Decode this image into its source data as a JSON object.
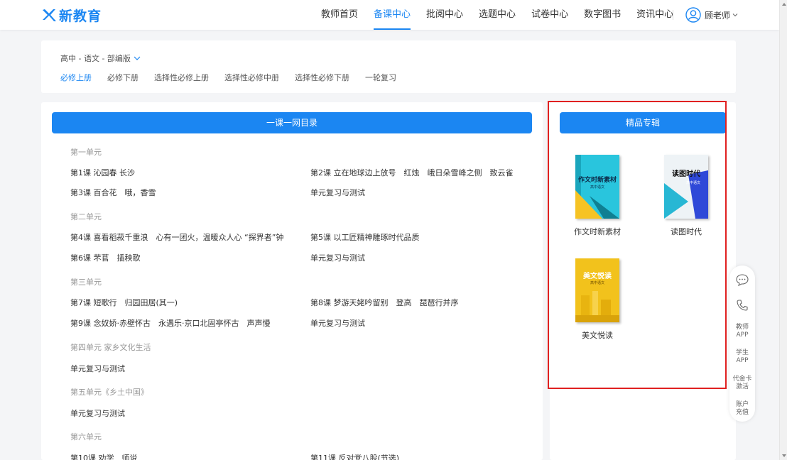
{
  "header": {
    "logo_text": "新教育",
    "nav": [
      "教师首页",
      "备课中心",
      "批阅中心",
      "选题中心",
      "试卷中心",
      "数字图书",
      "资讯中心"
    ],
    "active_nav": "备课中心",
    "user_name": "顾老师",
    "accent_color": "#1b86f2"
  },
  "filter": {
    "breadcrumb": "高中 - 语文 - 部编版",
    "tabs": [
      "必修上册",
      "必修下册",
      "选择性必修上册",
      "选择性必修中册",
      "选择性必修下册",
      "一轮复习"
    ],
    "active_tab": "必修上册"
  },
  "catalog": {
    "button_label": "一课一网目录",
    "units": [
      {
        "title": "第一单元",
        "lessons": [
          "第1课 沁园春 长沙",
          "第2课 立在地球边上放号　红烛　峨日朵雪峰之侧　致云雀",
          "第3课 百合花　哦，香雪",
          "单元复习与测试"
        ]
      },
      {
        "title": "第二单元",
        "lessons": [
          "第4课 喜看稻菽千重浪　心有一团火，温暖众人心 “探界者”钟...",
          "第5课 以工匠精神雕琢时代品质",
          "第6课 芣苢　插秧歌",
          "单元复习与测试"
        ]
      },
      {
        "title": "第三单元",
        "lessons": [
          "第7课 短歌行　归园田居(其一)",
          "第8课 梦游天姥吟留别　登高　琵琶行并序",
          "第9课 念奴娇·赤壁怀古　永遇乐·京口北固亭怀古　声声慢",
          "单元复习与测试"
        ]
      },
      {
        "title": "第四单元 家乡文化生活",
        "lessons": [
          "单元复习与测试"
        ]
      },
      {
        "title": "第五单元《乡土中国》",
        "lessons": [
          "单元复习与测试"
        ]
      },
      {
        "title": "第六单元",
        "lessons": [
          "第10课 劝学　师说",
          "第11课 反对党八股(节选)"
        ]
      }
    ]
  },
  "album": {
    "button_label": "精品专辑",
    "books": [
      {
        "label": "作文时新素材",
        "cover_title": "作文时新素材",
        "cover_sub": "高中语文"
      },
      {
        "label": "读图时代",
        "cover_title": "读图时代",
        "cover_sub": "高中语文"
      },
      {
        "label": "美文悦读",
        "cover_title": "美文悦读",
        "cover_sub": "高中语文"
      }
    ]
  },
  "side": {
    "teacher_app": [
      "教师",
      "APP"
    ],
    "student_app": [
      "学生",
      "APP"
    ],
    "voucher": [
      "代金卡",
      "激活"
    ],
    "recharge": [
      "账户",
      "充值"
    ]
  }
}
